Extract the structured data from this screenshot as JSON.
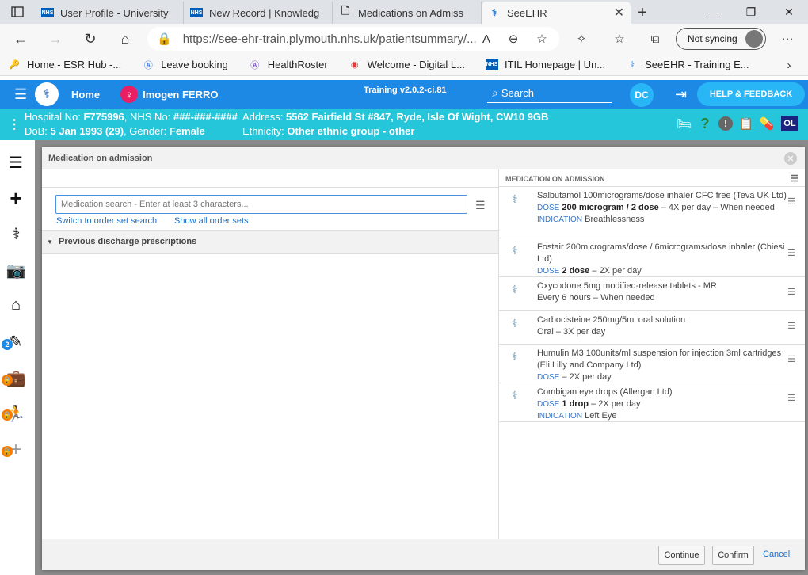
{
  "browser": {
    "tabs": [
      {
        "title": "User Profile - University",
        "icon": "nhs-favicon"
      },
      {
        "title": "New Record | Knowledg",
        "icon": "nhs-favicon"
      },
      {
        "title": "Medications on Admiss",
        "icon": "document-icon"
      },
      {
        "title": "SeeEHR",
        "icon": "seeehr-favicon"
      }
    ],
    "url": "https://see-ehr-train.plymouth.nhs.uk/patientsummary/...",
    "sync_label": "Not syncing",
    "favorites": [
      {
        "label": "Home - ESR Hub -...",
        "icon": "esr-icon"
      },
      {
        "label": "Leave booking",
        "icon": "letter-a-icon"
      },
      {
        "label": "HealthRoster",
        "icon": "letter-a-icon"
      },
      {
        "label": "Welcome - Digital L...",
        "icon": "circle-icon"
      },
      {
        "label": "ITIL Homepage | Un...",
        "icon": "nhs-favicon"
      },
      {
        "label": "SeeEHR - Training E...",
        "icon": "seeehr-favicon"
      }
    ]
  },
  "ehr": {
    "home_label": "Home",
    "patient_name": "Imogen FERRO",
    "version": "Training v2.0.2-ci.81",
    "search_label": "Search",
    "user_initials": "DC",
    "help_label": "HELP & FEEDBACK",
    "banner": {
      "hospital_no_label": "Hospital No:",
      "hospital_no": "F775996",
      "nhs_no_label": ", NHS No:",
      "nhs_no": "###-###-####",
      "dob_label": "DoB:",
      "dob": "5 Jan 1993 (29)",
      "gender_label": ", Gender:",
      "gender": "Female",
      "address_label": "Address:",
      "address": "5562 Fairfield St #847, Ryde, Isle Of Wight, CW10 9GB",
      "ethnicity_label": "Ethnicity:",
      "ethnicity": "Other ethnic group - other",
      "ol_badge": "OL"
    },
    "sidebar_badge": "2"
  },
  "modal": {
    "title": "Medication on admission",
    "search_placeholder": "Medication search - Enter at least 3 characters...",
    "switch_link": "Switch to order set search",
    "show_all_link": "Show all order sets",
    "prev_discharge": "Previous discharge prescriptions",
    "right_header": "MEDICATION ON ADMISSION",
    "meds": [
      {
        "name": "Salbutamol 100micrograms/dose inhaler CFC free (Teva UK Ltd)",
        "dose_label": "DOSE",
        "dose": "200 microgram / 2 dose",
        "freq": " – 4X per day – When needed",
        "ind_label": "INDICATION",
        "indication": "Breathlessness"
      },
      {
        "name": "Fostair 200micrograms/dose / 6micrograms/dose inhaler (Chiesi Ltd)",
        "dose_label": "DOSE",
        "dose": "2 dose",
        "freq": " – 2X per day",
        "ind_label": "",
        "indication": ""
      },
      {
        "name": "Oxycodone 5mg modified-release tablets - MR",
        "dose_label": "",
        "dose": "",
        "freq": "Every 6 hours – When needed",
        "ind_label": "",
        "indication": ""
      },
      {
        "name": "Carbocisteine 250mg/5ml oral solution",
        "dose_label": "",
        "dose": "",
        "freq": "Oral – 3X per day",
        "ind_label": "",
        "indication": ""
      },
      {
        "name": "Humulin M3 100units/ml suspension for injection 3ml cartridges (Eli Lilly and Company Ltd)",
        "dose_label": "DOSE",
        "dose": "",
        "freq": " – 2X per day",
        "ind_label": "",
        "indication": ""
      },
      {
        "name": "Combigan eye drops (Allergan Ltd)",
        "dose_label": "DOSE",
        "dose": "1 drop",
        "freq": " – 2X per day",
        "ind_label": "INDICATION",
        "indication": "Left Eye"
      }
    ],
    "continue_label": "Continue",
    "confirm_label": "Confirm",
    "cancel_label": "Cancel"
  }
}
